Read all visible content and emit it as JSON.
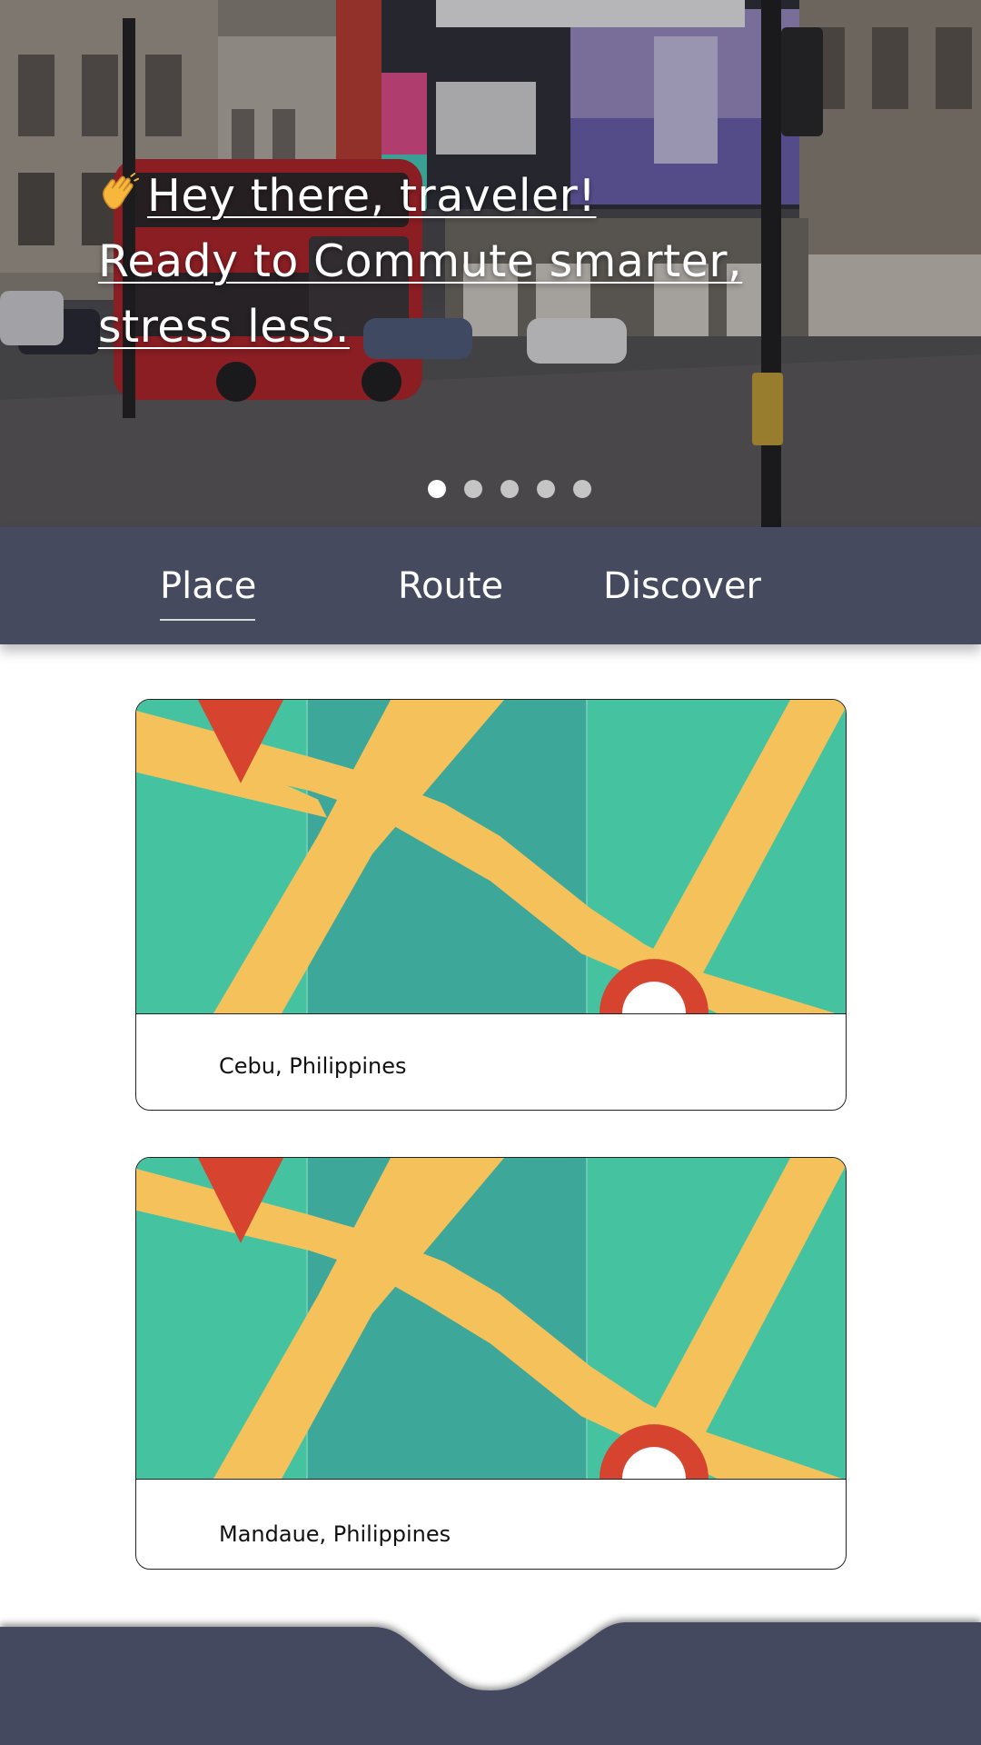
{
  "hero": {
    "greeting_line1": "Hey there, traveler!",
    "greeting_line2": "Ready to Commute smarter,",
    "greeting_line3": "stress less.",
    "wave_icon": "waving-hand-icon",
    "carousel_total": 5,
    "carousel_active_index": 0
  },
  "tabs": [
    {
      "label": "Place",
      "active": true
    },
    {
      "label": "Route",
      "active": false
    },
    {
      "label": "Discover",
      "active": false
    }
  ],
  "places": [
    {
      "name": "Cebu, Philippines",
      "icon": "map-pin-icon"
    },
    {
      "name": "Mandaue, Philippines",
      "icon": "map-pin-icon"
    }
  ],
  "colors": {
    "nav_bg": "#454a5e",
    "map_green": "#45c3a1",
    "map_green_dark": "#3da799",
    "map_road": "#f5c15a",
    "map_pin": "#d6432f"
  }
}
